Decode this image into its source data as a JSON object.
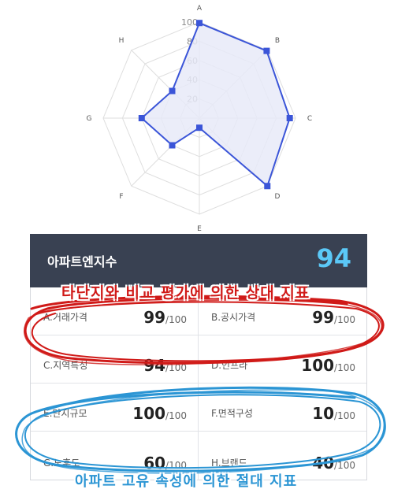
{
  "chart_data": {
    "type": "radar",
    "axes": [
      "A",
      "B",
      "C",
      "D",
      "E",
      "F",
      "G",
      "H"
    ],
    "values": [
      99,
      99,
      94,
      100,
      10,
      40,
      60,
      40
    ],
    "tick_labels": [
      "20",
      "40",
      "60",
      "80",
      "100"
    ],
    "range": [
      0,
      100
    ],
    "fill_color": "#e8eaf8",
    "line_color": "#3b55d8",
    "grid": true
  },
  "panel": {
    "title": "아파트엔지수",
    "score": "94",
    "header_color": "#394152",
    "score_color": "#5bc8f7",
    "items": [
      {
        "label": "A.거래가격",
        "value": "99",
        "max": "/100"
      },
      {
        "label": "B.공시가격",
        "value": "99",
        "max": "/100"
      },
      {
        "label": "C.지역특성",
        "value": "94",
        "max": "/100"
      },
      {
        "label": "D.인프라",
        "value": "100",
        "max": "/100"
      },
      {
        "label": "E.단지규모",
        "value": "100",
        "max": "/100"
      },
      {
        "label": "F.면적구성",
        "value": "10",
        "max": "/100"
      },
      {
        "label": "G.노후도",
        "value": "60",
        "max": "/100"
      },
      {
        "label": "H.브랜드",
        "value": "40",
        "max": "/100"
      }
    ]
  },
  "annotations": {
    "relative": "타단지와 비교 평가에 의한 상대 지표",
    "absolute": "아파트 고유 속성에 의한 절대 지표",
    "red_color": "#d01a18",
    "blue_color": "#2b95d4"
  }
}
